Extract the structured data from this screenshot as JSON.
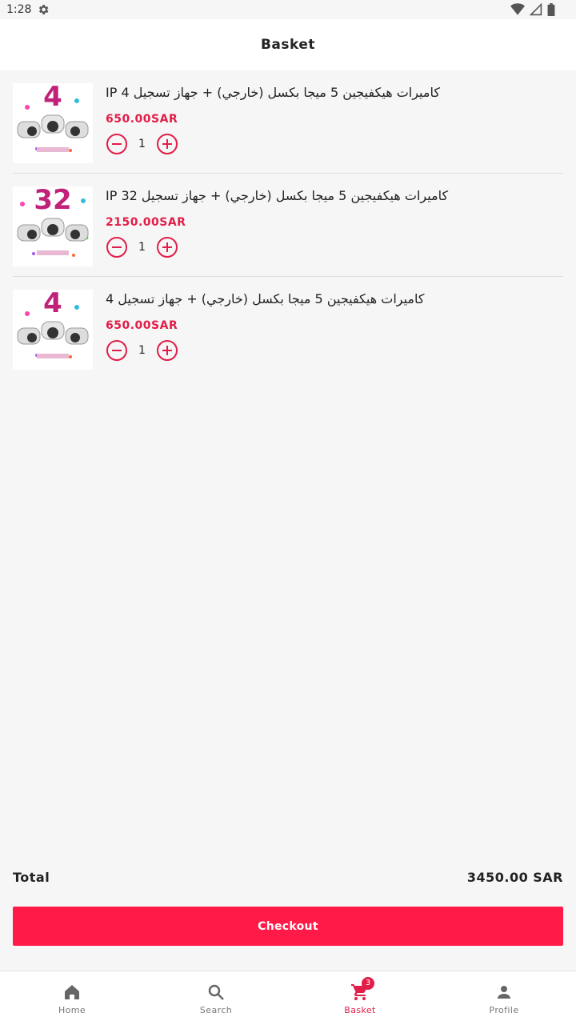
{
  "status_bar": {
    "time": "1:28"
  },
  "header": {
    "title": "Basket"
  },
  "items": [
    {
      "name": "IP كاميرات هيكفيجين 5 ميجا بكسل (خارجي) + جهاز تسجيل 4",
      "price": "650.00SAR",
      "quantity": "1",
      "thumb_number": "4"
    },
    {
      "name": "IP كاميرات هيكفيجين 5 ميجا بكسل (خارجي) + جهاز تسجيل 32",
      "price": "2150.00SAR",
      "quantity": "1",
      "thumb_number": "32"
    },
    {
      "name": "كاميرات هيكفيجين 5 ميجا بكسل (خارجي) + جهاز تسجيل 4",
      "price": "650.00SAR",
      "quantity": "1",
      "thumb_number": "4"
    }
  ],
  "summary": {
    "total_label": "Total",
    "total_value": "3450.00 SAR"
  },
  "checkout": {
    "label": "Checkout"
  },
  "nav": {
    "home": "Home",
    "search": "Search",
    "basket": "Basket",
    "basket_badge": "3",
    "profile": "Profile"
  },
  "colors": {
    "accent": "#e11d48",
    "button": "#ff1a48",
    "background": "#f6f6f6"
  },
  "icons": [
    "settings-gear-icon",
    "wifi-icon",
    "signal-icon",
    "battery-icon",
    "minus-icon",
    "plus-icon",
    "home-icon",
    "search-icon",
    "cart-icon",
    "person-icon"
  ]
}
